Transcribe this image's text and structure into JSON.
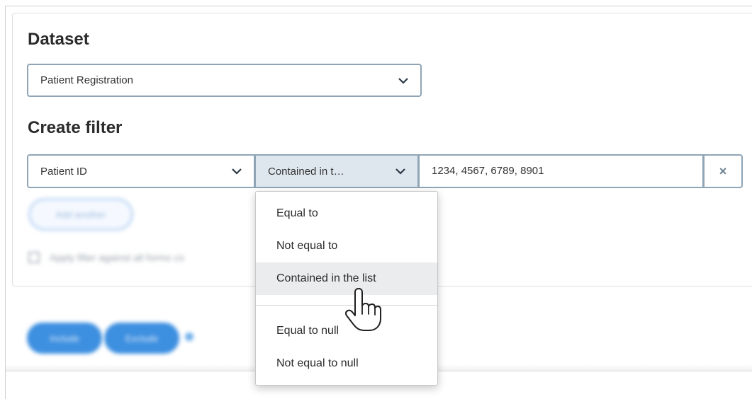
{
  "dataset": {
    "heading": "Dataset",
    "selected": "Patient Registration"
  },
  "filter": {
    "heading": "Create filter",
    "field": "Patient ID",
    "operator": "Contained in t…",
    "value": "1234, 4567, 6789, 8901",
    "remove_symbol": "×"
  },
  "operator_menu": {
    "items": [
      "Equal to",
      "Not equal to",
      "Contained in the list",
      "Equal to null",
      "Not equal to null"
    ],
    "highlighted": "Contained in the list"
  },
  "blurred": {
    "add_another": "Add another",
    "apply_all": "Apply filter against all forms co",
    "include": "Include",
    "exclude": "Exclude"
  },
  "colors": {
    "border": "#8fa5b6",
    "operator_bg": "#dfe7ee",
    "primary": "#3d8fe0"
  },
  "icons": [
    "chevron-down-icon",
    "close-icon",
    "hand-pointer-cursor-icon",
    "info-icon",
    "checkbox-icon"
  ]
}
